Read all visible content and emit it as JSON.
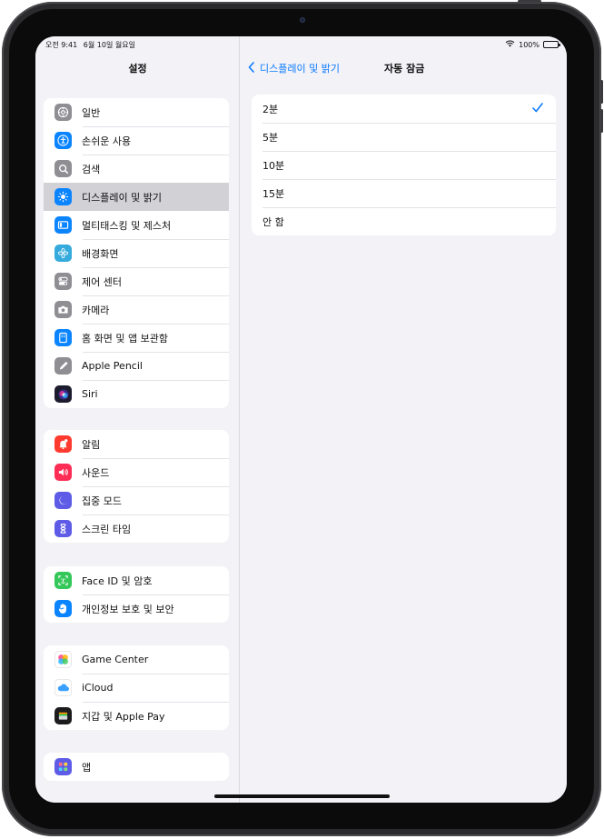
{
  "status_bar": {
    "time": "오전 9:41",
    "date": "6월 10일 월요일",
    "battery_percent": "100%",
    "battery_level": 1.0
  },
  "sidebar": {
    "title": "설정",
    "groups": [
      [
        {
          "label": "일반",
          "icon": "gear-icon",
          "color": "#8e8e93"
        },
        {
          "label": "손쉬운 사용",
          "icon": "accessibility-icon",
          "color": "#0a84ff"
        },
        {
          "label": "검색",
          "icon": "search-icon",
          "color": "#8e8e93"
        },
        {
          "label": "디스플레이 및 밝기",
          "icon": "brightness-icon",
          "color": "#0a84ff",
          "selected": true
        },
        {
          "label": "멀티태스킹 및 제스처",
          "icon": "multitasking-icon",
          "color": "#0a84ff"
        },
        {
          "label": "배경화면",
          "icon": "wallpaper-flower-icon",
          "color": "#35aadc"
        },
        {
          "label": "제어 센터",
          "icon": "control-center-icon",
          "color": "#8e8e93"
        },
        {
          "label": "카메라",
          "icon": "camera-icon",
          "color": "#8e8e93"
        },
        {
          "label": "홈 화면 및 앱 보관함",
          "icon": "home-screen-icon",
          "color": "#0a84ff"
        },
        {
          "label": "Apple Pencil",
          "icon": "pencil-icon",
          "color": "#8e8e93"
        },
        {
          "label": "Siri",
          "icon": "siri-icon",
          "color": "#222233"
        }
      ],
      [
        {
          "label": "알림",
          "icon": "bell-icon",
          "color": "#ff3b30"
        },
        {
          "label": "사운드",
          "icon": "speaker-icon",
          "color": "#ff2d55"
        },
        {
          "label": "집중 모드",
          "icon": "moon-icon",
          "color": "#5e5ce6"
        },
        {
          "label": "스크린 타임",
          "icon": "hourglass-icon",
          "color": "#5e5ce6"
        }
      ],
      [
        {
          "label": "Face ID 및 암호",
          "icon": "face-id-icon",
          "color": "#34c759"
        },
        {
          "label": "개인정보 보호 및 보안",
          "icon": "hand-icon",
          "color": "#0a84ff"
        }
      ],
      [
        {
          "label": "Game Center",
          "icon": "game-center-icon",
          "color": "#ffffff"
        },
        {
          "label": "iCloud",
          "icon": "cloud-icon",
          "color": "#ffffff"
        },
        {
          "label": "지갑 및 Apple Pay",
          "icon": "wallet-icon",
          "color": "#1c1c1e"
        }
      ],
      [
        {
          "label": "앱",
          "icon": "apps-grid-icon",
          "color": "#5e5ce6"
        }
      ]
    ]
  },
  "detail": {
    "back_label": "디스플레이 및 밝기",
    "title": "자동 잠금",
    "options": [
      {
        "label": "2분",
        "checked": true
      },
      {
        "label": "5분"
      },
      {
        "label": "10분"
      },
      {
        "label": "15분"
      },
      {
        "label": "안 함"
      }
    ]
  },
  "colors": {
    "accent": "#0a7aff",
    "background": "#f2f2f7",
    "selected_row": "#d1d1d6"
  }
}
